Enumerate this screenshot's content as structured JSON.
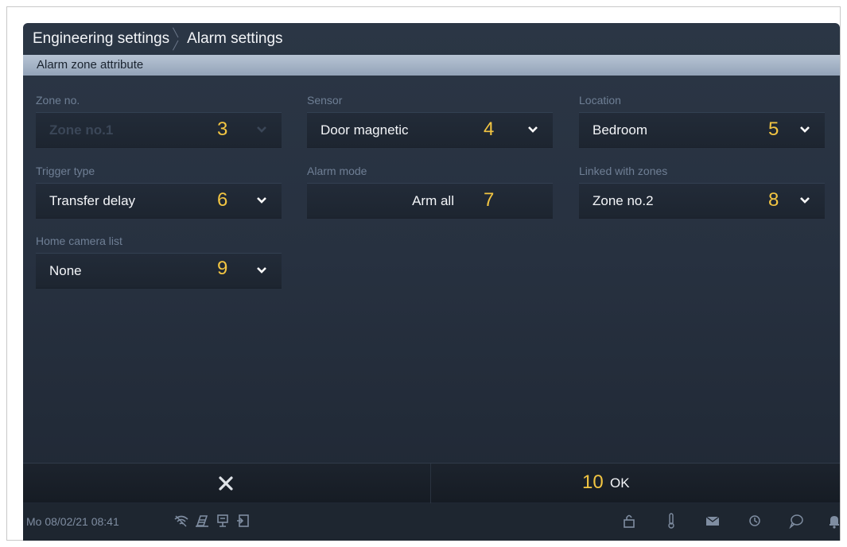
{
  "breadcrumb": {
    "root": "Engineering settings",
    "current": "Alarm settings"
  },
  "section_title": "Alarm zone attribute",
  "fields": {
    "zone_no": {
      "label": "Zone no.",
      "value": "Zone no.1",
      "marker": "3",
      "disabled": true
    },
    "sensor": {
      "label": "Sensor",
      "value": "Door magnetic",
      "marker": "4"
    },
    "location": {
      "label": "Location",
      "value": "Bedroom",
      "marker": "5"
    },
    "trigger_type": {
      "label": "Trigger type",
      "value": "Transfer delay",
      "marker": "6"
    },
    "alarm_mode": {
      "label": "Alarm mode",
      "value": "Arm all",
      "marker": "7"
    },
    "linked_zones": {
      "label": "Linked with zones",
      "value": "Zone no.2",
      "marker": "8"
    },
    "home_camera": {
      "label": "Home camera list",
      "value": "None",
      "marker": "9"
    }
  },
  "bottom": {
    "ok_marker": "10",
    "ok_label": "OK"
  },
  "status": {
    "datetime": "Mo 08/02/21  08:41",
    "left_icons": [
      "wifi-icon",
      "ringtone-mute-icon",
      "screen-icon",
      "door-exit-icon"
    ],
    "right_icons": [
      "lock-icon",
      "thermometer-icon",
      "mail-icon",
      "history-icon",
      "message-icon",
      "bell-icon"
    ]
  },
  "colors": {
    "marker": "#f2c542",
    "label": "#6f7f95",
    "header_bar": "#a6b4c6"
  }
}
